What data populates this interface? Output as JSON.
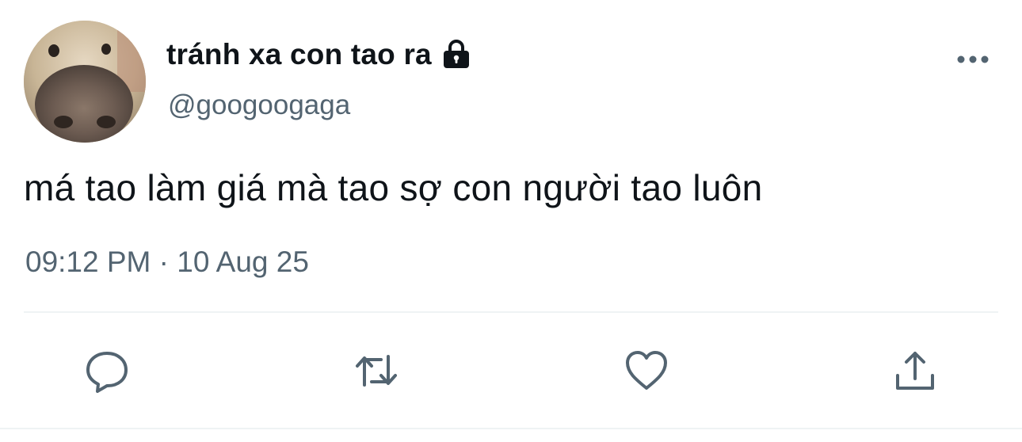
{
  "tweet": {
    "display_name": "tránh xa con tao ra",
    "handle": "@googoogaga",
    "protected_icon": "lock-icon",
    "text": "má tao làm giá mà tao sợ con người tao luôn",
    "timestamp": "09:12 PM · 10 Aug 25"
  },
  "actions": [
    {
      "name": "reply",
      "icon": "speech-bubble-icon"
    },
    {
      "name": "retweet",
      "icon": "retweet-arrows-icon"
    },
    {
      "name": "like",
      "icon": "heart-icon"
    },
    {
      "name": "share",
      "icon": "share-upload-icon"
    }
  ],
  "menu": {
    "icon": "more-horizontal-icon"
  },
  "colors": {
    "text_primary": "#0f1419",
    "text_secondary": "#536471",
    "divider": "#eff3f4"
  }
}
